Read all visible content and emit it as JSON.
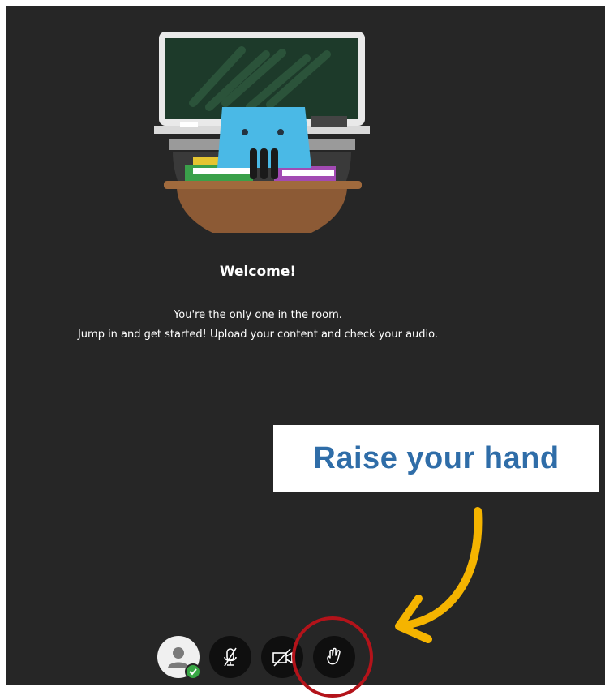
{
  "welcome": {
    "title": "Welcome!",
    "line1": "You're the only one in the room.",
    "line2": "Jump in and get started! Upload your content and check your audio."
  },
  "callout": {
    "text": "Raise your hand"
  },
  "controls": {
    "items": [
      {
        "name": "avatar",
        "icon": "user-avatar-icon",
        "status": "connected-check-icon"
      },
      {
        "name": "microphone-toggle",
        "icon": "mic-off-icon"
      },
      {
        "name": "camera-toggle",
        "icon": "camera-off-icon"
      },
      {
        "name": "raise-hand",
        "icon": "raise-hand-icon"
      }
    ]
  },
  "colors": {
    "stage_bg": "#262626",
    "callout_text": "#2f6da8",
    "arrow": "#f5b400",
    "highlight_ring": "#b3131a",
    "status_green": "#38a745"
  }
}
